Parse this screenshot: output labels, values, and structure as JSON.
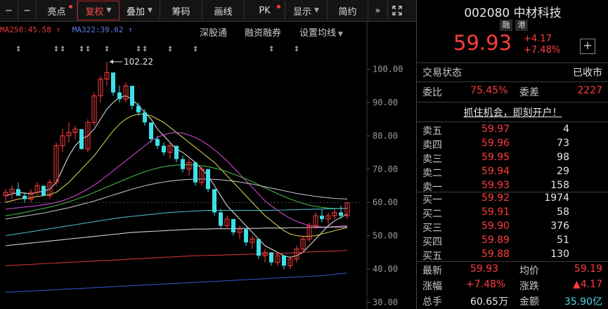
{
  "toolbar": {
    "items": [
      {
        "label": "亮点",
        "dot": true
      },
      {
        "label": "复权",
        "caret": true,
        "active": true
      },
      {
        "label": "叠加",
        "caret": true
      },
      {
        "label": "筹码"
      },
      {
        "label": "画线"
      },
      {
        "label": "PK",
        "dot": true
      },
      {
        "label": "显示",
        "caret": true
      },
      {
        "label": "简约"
      }
    ],
    "icon_minus1": "−",
    "icon_minus2": "−",
    "nav": "»"
  },
  "ma": {
    "ma250": "MA250:45.58 ↑",
    "ma322": "MA322:39.62 ↑"
  },
  "menu": {
    "shengutong": "深股通",
    "rzrq": "融资融券",
    "szjx": "设置均线"
  },
  "chart_data": {
    "type": "candlestick",
    "y_ticks": [
      "100.00",
      "90.00",
      "80.00",
      "70.00",
      "60.00",
      "50.00",
      "40.00",
      "30.00"
    ],
    "ylim": [
      28,
      106
    ],
    "peak_label": "102.22",
    "peak_value": 102.22,
    "candles": [
      [
        62,
        64,
        60,
        63
      ],
      [
        63,
        65,
        61,
        64
      ],
      [
        64,
        66,
        62,
        62
      ],
      [
        62,
        63,
        60,
        61
      ],
      [
        61,
        64,
        60,
        63
      ],
      [
        63,
        66,
        62,
        65
      ],
      [
        65,
        64,
        62,
        62
      ],
      [
        62,
        67,
        61,
        66
      ],
      [
        66,
        78,
        65,
        77
      ],
      [
        77,
        82,
        75,
        80
      ],
      [
        80,
        84,
        78,
        81
      ],
      [
        81,
        83,
        79,
        82
      ],
      [
        82,
        80,
        76,
        76
      ],
      [
        76,
        85,
        75,
        84
      ],
      [
        84,
        93,
        83,
        92
      ],
      [
        92,
        98,
        90,
        97
      ],
      [
        97,
        102.22,
        95,
        99
      ],
      [
        99,
        97,
        92,
        93
      ],
      [
        93,
        95,
        90,
        91
      ],
      [
        91,
        96,
        90,
        95
      ],
      [
        95,
        92,
        88,
        89
      ],
      [
        89,
        90,
        86,
        87
      ],
      [
        87,
        88,
        83,
        84
      ],
      [
        84,
        82,
        78,
        79
      ],
      [
        79,
        80,
        76,
        77
      ],
      [
        77,
        78,
        74,
        75
      ],
      [
        75,
        78,
        73,
        77
      ],
      [
        77,
        76,
        72,
        73
      ],
      [
        73,
        74,
        69,
        70
      ],
      [
        70,
        73,
        68,
        72
      ],
      [
        72,
        70,
        65,
        66
      ],
      [
        66,
        71,
        65,
        70
      ],
      [
        70,
        68,
        63,
        64
      ],
      [
        64,
        62,
        56,
        57
      ],
      [
        57,
        58,
        52,
        53
      ],
      [
        53,
        56,
        52,
        55
      ],
      [
        55,
        54,
        50,
        51
      ],
      [
        51,
        53,
        49,
        52
      ],
      [
        52,
        51,
        47,
        48
      ],
      [
        48,
        50,
        46,
        49
      ],
      [
        49,
        47,
        43,
        44
      ],
      [
        44,
        46,
        42,
        45
      ],
      [
        45,
        44,
        41,
        42
      ],
      [
        42,
        45,
        41,
        44
      ],
      [
        44,
        42,
        40,
        41
      ],
      [
        41,
        44,
        40,
        43
      ],
      [
        43,
        47,
        42,
        46
      ],
      [
        46,
        50,
        45,
        49
      ],
      [
        49,
        54,
        48,
        53
      ],
      [
        53,
        57,
        52,
        56
      ],
      [
        56,
        58,
        54,
        55
      ],
      [
        55,
        57,
        53,
        56
      ],
      [
        56,
        58,
        55,
        57
      ],
      [
        57,
        59,
        55,
        56
      ],
      [
        56,
        60,
        55,
        59.93
      ]
    ],
    "ma_series": [
      {
        "color": "#f2f2f2",
        "values": [
          62,
          62.5,
          63,
          62.8,
          62.5,
          63,
          63.4,
          64,
          66,
          70,
          74,
          77,
          79,
          80,
          82,
          85,
          88,
          90,
          91.5,
          92,
          91,
          89,
          87,
          85,
          82,
          80,
          78,
          76,
          75,
          73.5,
          72,
          70,
          68,
          65,
          62,
          59,
          57,
          55,
          53,
          51,
          49,
          47,
          46,
          45,
          44,
          43.5,
          44,
          45,
          47,
          49,
          51,
          53,
          54.5,
          55.5,
          56.5
        ]
      },
      {
        "color": "#e6e25a",
        "values": [
          60,
          60.5,
          61,
          61.2,
          61.4,
          61.8,
          62,
          62.4,
          63,
          64.5,
          66,
          68,
          70,
          72,
          74,
          76.5,
          79,
          81.5,
          83.5,
          85,
          86,
          86.5,
          86.5,
          86,
          85,
          84,
          82.5,
          81,
          79.5,
          78,
          76.5,
          75,
          73.5,
          72,
          70,
          68,
          66,
          64,
          62,
          60,
          58,
          56,
          54.5,
          53,
          51.5,
          50.5,
          50,
          49.8,
          49.8,
          50,
          50.5,
          51,
          51.5,
          52,
          52.5
        ]
      },
      {
        "color": "#e64ae6",
        "values": [
          58,
          58.2,
          58.4,
          58.6,
          58.8,
          59,
          59.3,
          59.6,
          60,
          60.5,
          61.2,
          62,
          63,
          64,
          65.2,
          66.5,
          68,
          69.5,
          71,
          72.5,
          74,
          75.5,
          77,
          78.5,
          79.5,
          80.3,
          80.8,
          81,
          80.8,
          80.2,
          79.5,
          78.5,
          77.2,
          75.8,
          74.2,
          72.5,
          70.5,
          68.5,
          66.5,
          64.5,
          62.5,
          60.5,
          59,
          57.6,
          56.3,
          55.2,
          54.3,
          53.6,
          53.1,
          52.8,
          52.6,
          52.6,
          52.7,
          52.9,
          53.1
        ]
      },
      {
        "color": "#4ac84a",
        "values": [
          56,
          56.3,
          56.6,
          57,
          57.4,
          57.8,
          58.2,
          58.6,
          59.1,
          59.6,
          60.2,
          60.8,
          61.5,
          62.2,
          63,
          63.8,
          64.6,
          65.4,
          66.2,
          67,
          67.8,
          68.5,
          69.2,
          69.8,
          70.3,
          70.7,
          71,
          71.2,
          71.3,
          71.3,
          71.2,
          71,
          70.7,
          70.3,
          69.8,
          69.2,
          68.5,
          67.8,
          67,
          66.2,
          65.3,
          64.4,
          63.5,
          62.6,
          61.8,
          61,
          60.3,
          59.7,
          59.2,
          58.8,
          58.5,
          58.3,
          58.2,
          58.2,
          58.3
        ]
      },
      {
        "color": "#cfcfcf",
        "values": [
          55,
          55.3,
          55.6,
          55.9,
          56.2,
          56.5,
          56.8,
          57.2,
          57.6,
          58,
          58.4,
          58.9,
          59.4,
          59.9,
          60.4,
          61,
          61.6,
          62.2,
          62.8,
          63.4,
          64,
          64.5,
          65,
          65.4,
          65.8,
          66.1,
          66.4,
          66.6,
          66.8,
          66.9,
          67,
          67,
          67,
          66.9,
          66.8,
          66.6,
          66.4,
          66.1,
          65.8,
          65.5,
          65.1,
          64.7,
          64.3,
          63.9,
          63.5,
          63.1,
          62.7,
          62.4,
          62.1,
          61.8,
          61.6,
          61.4,
          61.2,
          61.1,
          61
        ]
      },
      {
        "color": "#4ac8d8",
        "values": [
          50,
          50.3,
          50.6,
          50.9,
          51.2,
          51.5,
          51.8,
          52.1,
          52.4,
          52.7,
          53,
          53.3,
          53.6,
          53.9,
          54.2,
          54.5,
          54.8,
          55.1,
          55.4,
          55.6,
          55.8,
          56,
          56.2,
          56.4,
          56.6,
          56.8,
          57,
          57.1,
          57.2,
          57.3,
          57.4,
          57.5,
          57.6,
          57.6,
          57.6,
          57.6,
          57.6,
          57.6,
          57.6,
          57.6,
          57.6,
          57.6,
          57.6,
          57.7,
          57.7,
          57.8,
          57.8,
          57.9,
          57.9,
          58,
          58,
          58.1,
          58.1,
          58.2,
          58.2
        ]
      },
      {
        "color": "#e8e8e8",
        "values": [
          47,
          47.2,
          47.4,
          47.6,
          47.8,
          48,
          48.2,
          48.4,
          48.6,
          48.8,
          49,
          49.2,
          49.4,
          49.6,
          49.8,
          50,
          50.2,
          50.4,
          50.6,
          50.8,
          51,
          51.1,
          51.2,
          51.3,
          51.4,
          51.5,
          51.6,
          51.7,
          51.8,
          51.9,
          52,
          52,
          52,
          52.1,
          52.1,
          52.1,
          52.1,
          52.2,
          52.2,
          52.2,
          52.2,
          52.3,
          52.3,
          52.3,
          52.3,
          52.4,
          52.4,
          52.4,
          52.5,
          52.5,
          52.5,
          52.6,
          52.6,
          52.6,
          52.7
        ]
      },
      {
        "color": "#e03a3a",
        "values": [
          41,
          41.1,
          41.2,
          41.3,
          41.4,
          41.5,
          41.6,
          41.7,
          41.8,
          41.9,
          42,
          42.1,
          42.2,
          42.3,
          42.4,
          42.5,
          42.6,
          42.7,
          42.8,
          42.9,
          43,
          43.1,
          43.2,
          43.3,
          43.4,
          43.5,
          43.6,
          43.7,
          43.8,
          43.9,
          44,
          44.05,
          44.1,
          44.15,
          44.2,
          44.25,
          44.3,
          44.35,
          44.4,
          44.45,
          44.5,
          44.55,
          44.6,
          44.65,
          44.7,
          44.8,
          44.9,
          45,
          45.1,
          45.2,
          45.3,
          45.35,
          45.4,
          45.5,
          45.58
        ]
      },
      {
        "color": "#3a5ad8",
        "values": [
          33,
          33.1,
          33.2,
          33.3,
          33.4,
          33.5,
          33.6,
          33.7,
          33.8,
          33.9,
          34,
          34.1,
          34.2,
          34.3,
          34.4,
          34.5,
          34.6,
          34.7,
          34.8,
          34.9,
          35,
          35.1,
          35.2,
          35.3,
          35.4,
          35.5,
          35.6,
          35.7,
          35.8,
          35.9,
          36,
          36.1,
          36.2,
          36.3,
          36.4,
          36.5,
          36.6,
          36.7,
          36.8,
          36.9,
          37,
          37.1,
          37.2,
          37.3,
          37.4,
          37.5,
          37.6,
          37.7,
          37.8,
          37.9,
          38,
          38.2,
          38.4,
          38.6,
          38.8
        ]
      }
    ],
    "marker_positions": [
      2,
      8,
      9,
      12,
      13,
      16,
      21,
      22,
      26,
      30,
      42,
      46
    ]
  },
  "quote": {
    "code_name": "002080 中材科技",
    "tag1": "融",
    "tag2": "港",
    "price": "59.93",
    "chg": "+4.17",
    "chg_pct": "+7.48%",
    "plus": "+",
    "trade_state_label": "交易状态",
    "trade_state": "已收市",
    "wb_label": "委比",
    "wb": "75.45%",
    "wc_label": "委差",
    "wc": "2227",
    "promo": "抓住机会，即刻开户！"
  },
  "orderbook": {
    "asks": [
      {
        "name": "卖五",
        "price": "59.97",
        "vol": "4"
      },
      {
        "name": "卖四",
        "price": "59.96",
        "vol": "73"
      },
      {
        "name": "卖三",
        "price": "59.95",
        "vol": "98"
      },
      {
        "name": "卖二",
        "price": "59.94",
        "vol": "29"
      },
      {
        "name": "卖一",
        "price": "59.93",
        "vol": "158"
      }
    ],
    "bids": [
      {
        "name": "买一",
        "price": "59.92",
        "vol": "1974"
      },
      {
        "name": "买二",
        "price": "59.91",
        "vol": "58"
      },
      {
        "name": "买三",
        "price": "59.90",
        "vol": "376"
      },
      {
        "name": "买四",
        "price": "59.89",
        "vol": "51"
      },
      {
        "name": "买五",
        "price": "59.88",
        "vol": "130"
      }
    ]
  },
  "stats": {
    "last_label": "最新",
    "last": "59.93",
    "avg_label": "均价",
    "avg": "59.19",
    "pct_label": "涨幅",
    "pct": "+7.48%",
    "diff_label": "涨跌",
    "diff": "▲4.17",
    "vol_label": "总手",
    "vol": "60.65万",
    "amt_label": "金额",
    "amt": "35.90亿"
  }
}
